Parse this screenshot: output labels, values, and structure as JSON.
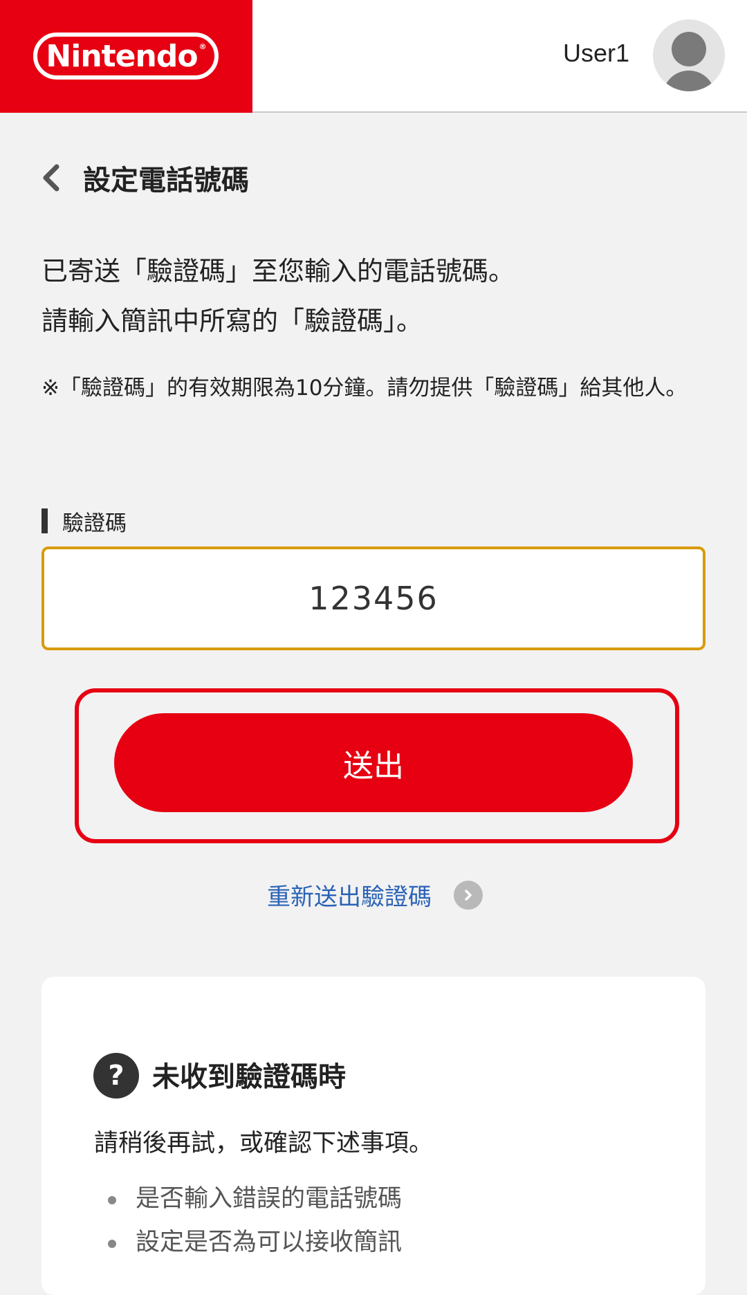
{
  "header": {
    "logo_text": "Nintendo",
    "logo_reg": "®",
    "username": "User1",
    "brand_color": "#e60012"
  },
  "title": {
    "back_icon": "chevron-left-icon",
    "text": "設定電話號碼"
  },
  "intro": {
    "line1": "已寄送「驗證碼」至您輸入的電話號碼。",
    "line2": "請輸入簡訊中所寫的「驗證碼」。"
  },
  "note": "※「驗證碼」的有效期限為10分鐘。請勿提供「驗證碼」給其他人。",
  "field": {
    "label": "驗證碼",
    "value": "123456",
    "border_color": "#d99a0a"
  },
  "submit": {
    "label": "送出"
  },
  "resend": {
    "label": "重新送出驗證碼",
    "icon": "chevron-right-circle-icon",
    "color": "#2b63b6"
  },
  "help": {
    "icon_glyph": "?",
    "title": "未收到驗證碼時",
    "text": "請稍後再試，或確認下述事項。",
    "items": [
      "是否輸入錯誤的電話號碼",
      "設定是否為可以接收簡訊"
    ]
  }
}
